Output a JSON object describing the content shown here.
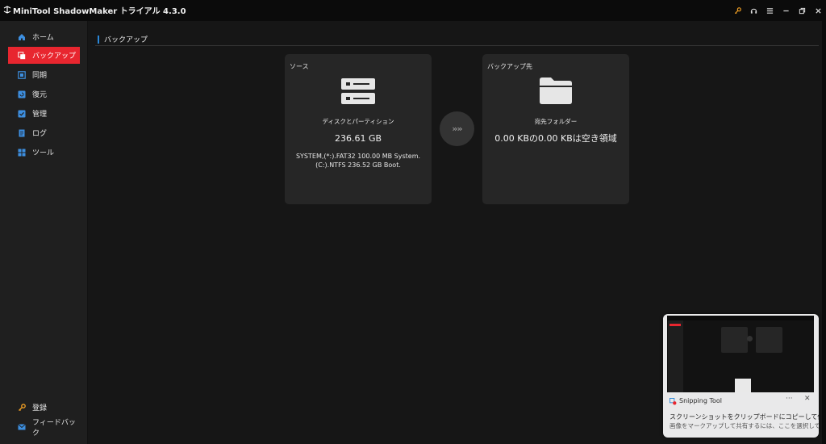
{
  "app": {
    "title": "MiniTool ShadowMaker トライアル 4.3.0",
    "titlebar_icons": [
      "key-icon",
      "headset-icon",
      "menu-icon",
      "minimize-icon",
      "restore-icon",
      "close-icon"
    ]
  },
  "sidebar": {
    "items": [
      {
        "label": "ホーム",
        "icon": "home-icon"
      },
      {
        "label": "バックアップ",
        "icon": "backup-icon",
        "active": true
      },
      {
        "label": "同期",
        "icon": "sync-icon"
      },
      {
        "label": "復元",
        "icon": "restore-icon"
      },
      {
        "label": "管理",
        "icon": "manage-icon"
      },
      {
        "label": "ログ",
        "icon": "log-icon"
      },
      {
        "label": "ツール",
        "icon": "tools-icon"
      }
    ],
    "bottom": [
      {
        "label": "登録",
        "icon": "key-icon"
      },
      {
        "label": "フィードバック",
        "icon": "mail-icon"
      }
    ]
  },
  "main": {
    "section_title": "バックアップ",
    "source": {
      "label": "ソース",
      "subtitle": "ディスクとパーティション",
      "size": "236.61 GB",
      "detail_line1": "SYSTEM,(*:).FAT32 100.00 MB System.",
      "detail_line2": "(C:).NTFS 236.52 GB Boot."
    },
    "destination": {
      "label": "バックアップ先",
      "subtitle": "宛先フォルダー",
      "info": "0.00 KBの0.00 KBは空き領域"
    },
    "arrow": "»»"
  },
  "toast": {
    "app_name": "Snipping Tool",
    "more": "···",
    "close": "✕",
    "message": "スクリーンショットをクリップボードにコピーして保存しました",
    "submessage": "画像をマークアップして共有するには、ここを選択してください"
  },
  "colors": {
    "accent_red": "#e8262f",
    "accent_blue": "#2a87d8",
    "key_orange": "#f2a024",
    "background": "#161616",
    "card": "#262626"
  }
}
